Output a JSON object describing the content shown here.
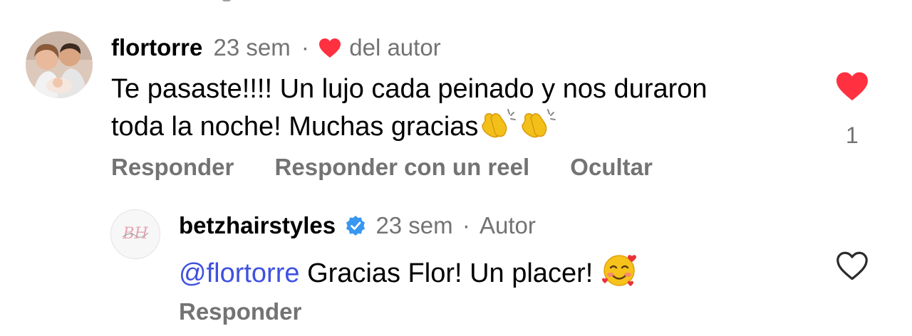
{
  "comment": {
    "username": "flortorre",
    "time": "23 sem",
    "separator": "·",
    "author_like_label": "del autor",
    "text_line1": "Te pasaste!!!! Un lujo cada peinado y nos duraron",
    "text_line2": "toda la noche! Muchas gracias",
    "like_count": "1",
    "actions": {
      "reply": "Responder",
      "reply_reel": "Responder con un reel",
      "hide": "Ocultar"
    }
  },
  "reply": {
    "username": "betzhairstyles",
    "time": "23 sem",
    "separator": "·",
    "author_label": "Autor",
    "mention": "@flortorre",
    "text": "Gracias Flor! Un placer!",
    "avatar_logo": "BH",
    "actions": {
      "reply": "Responder"
    }
  },
  "colors": {
    "like_red": "#ff3040",
    "verified_blue": "#3897f0",
    "mention_blue": "#3f51e0",
    "muted_gray": "#737373"
  },
  "icons": [
    "heart-icon",
    "heart-outline-icon",
    "verified-badge-icon",
    "clapping-hands-emoji",
    "smiling-face-with-hearts-emoji"
  ]
}
